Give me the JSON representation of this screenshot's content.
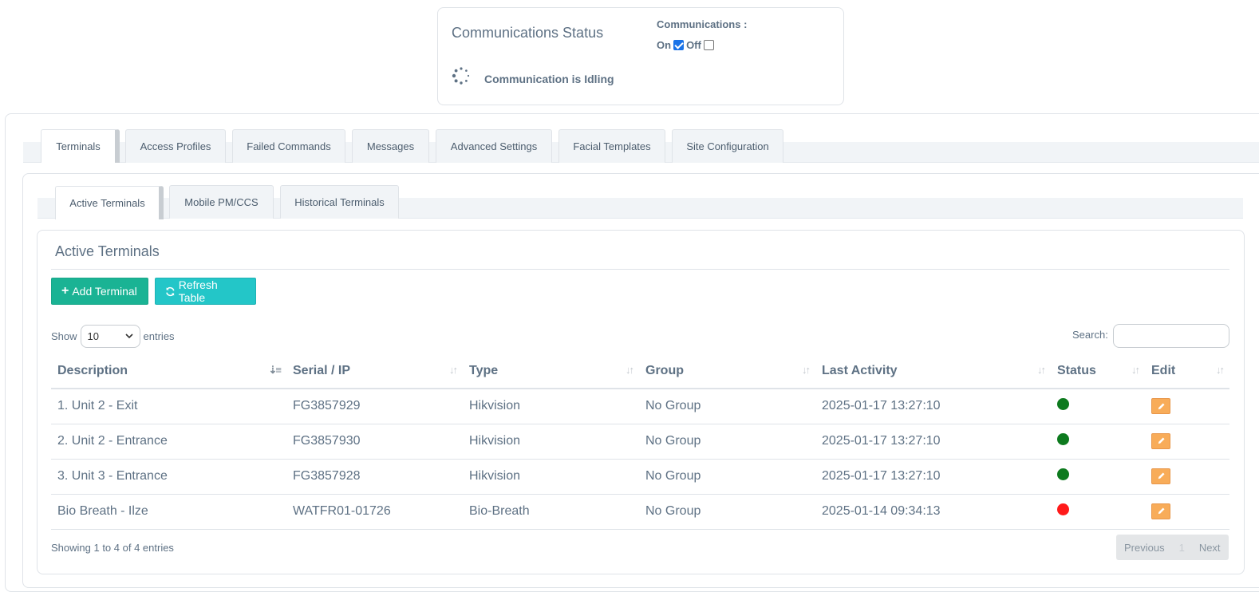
{
  "comm": {
    "title": "Communications Status",
    "label": "Communications :",
    "on_label": "On",
    "off_label": "Off",
    "on_checked": true,
    "off_checked": false,
    "status_text": "Communication is Idling"
  },
  "tabs": [
    {
      "label": "Terminals",
      "active": true
    },
    {
      "label": "Access Profiles",
      "active": false
    },
    {
      "label": "Failed Commands",
      "active": false
    },
    {
      "label": "Messages",
      "active": false
    },
    {
      "label": "Advanced Settings",
      "active": false
    },
    {
      "label": "Facial Templates",
      "active": false
    },
    {
      "label": "Site Configuration",
      "active": false
    }
  ],
  "subtabs": [
    {
      "label": "Active Terminals",
      "active": true
    },
    {
      "label": "Mobile PM/CCS",
      "active": false
    },
    {
      "label": "Historical Terminals",
      "active": false
    }
  ],
  "panel": {
    "title": "Active Terminals",
    "add_label": "Add Terminal",
    "refresh_label": "Refresh Table",
    "show_label": "Show",
    "entries_label": "entries",
    "page_size": "10",
    "search_label": "Search:",
    "search_value": ""
  },
  "table": {
    "columns": [
      "Description",
      "Serial / IP",
      "Type",
      "Group",
      "Last Activity",
      "Status",
      "Edit"
    ],
    "rows": [
      {
        "description": "1. Unit 2 - Exit",
        "serial": "FG3857929",
        "type": "Hikvision",
        "group": "No Group",
        "last_activity": "2025-01-17 13:27:10",
        "status": "online"
      },
      {
        "description": "2. Unit 2 - Entrance",
        "serial": "FG3857930",
        "type": "Hikvision",
        "group": "No Group",
        "last_activity": "2025-01-17 13:27:10",
        "status": "online"
      },
      {
        "description": "3. Unit 3 - Entrance",
        "serial": "FG3857928",
        "type": "Hikvision",
        "group": "No Group",
        "last_activity": "2025-01-17 13:27:10",
        "status": "online"
      },
      {
        "description": "Bio Breath - Ilze",
        "serial": "WATFR01-01726",
        "type": "Bio-Breath",
        "group": "No Group",
        "last_activity": "2025-01-14 09:34:13",
        "status": "offline"
      }
    ]
  },
  "status_colors": {
    "online": "#0d7a1e",
    "offline": "#ff1a1a"
  },
  "footer": {
    "info": "Showing 1 to 4 of 4 entries",
    "previous": "Previous",
    "current_page": "1",
    "next": "Next"
  }
}
